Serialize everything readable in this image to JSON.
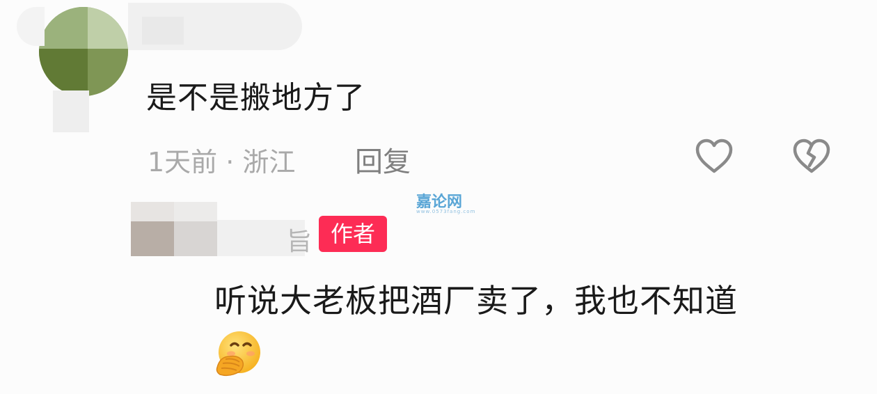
{
  "comment": {
    "text": "是不是搬地方了",
    "meta": "1天前 · 浙江",
    "reply_label": "回复",
    "like_icon": "heart-outline",
    "dislike_icon": "broken-heart"
  },
  "watermark": {
    "logo_text": "嘉论网",
    "url_text": "www.0573fang.com"
  },
  "reply": {
    "name_fragment": "旨",
    "badge": "作者",
    "text": "听说大老板把酒厂卖了，我也不知道",
    "emoji": "face-with-hand-over-mouth"
  },
  "colors": {
    "badge_bg": "#fd2c55",
    "meta_gray": "#a9a9a9",
    "reply_gray": "#7f7f7f"
  }
}
